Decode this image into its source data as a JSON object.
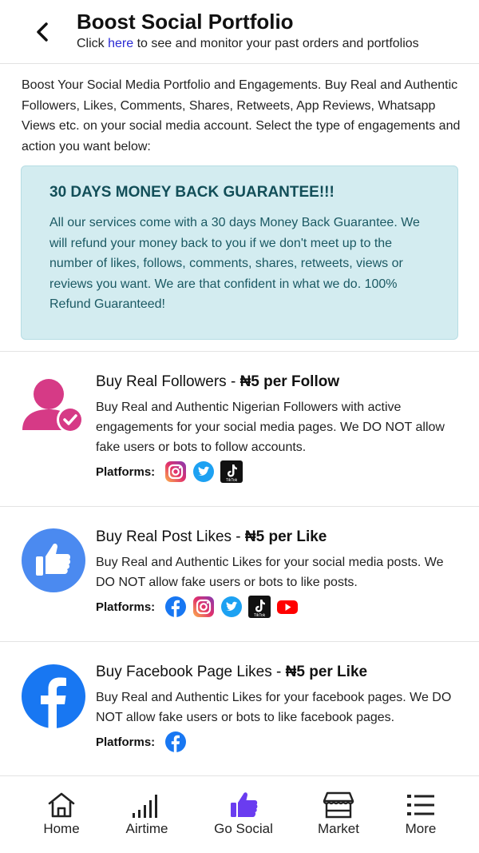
{
  "header": {
    "title": "Boost Social Portfolio",
    "subtitle_before": "Click ",
    "subtitle_link": "here",
    "subtitle_after": " to see and monitor your past orders and portfolios"
  },
  "intro": "Boost Your Social Media Portfolio and Engagements. Buy Real and Authentic Followers, Likes, Comments, Shares, Retweets, App Reviews, Whatsapp Views etc. on your social media account. Select the type of engagements and action you want below:",
  "guarantee": {
    "title": "30 DAYS MONEY BACK GUARANTEE!!!",
    "text": "All our services come with a 30 days Money Back Guarantee. We will refund your money back to you if we don't meet up to the number of likes, follows, comments, shares, retweets, views or reviews you want. We are that confident in what we do. 100% Refund Guaranteed!"
  },
  "services": [
    {
      "title": "Buy Real Followers - ",
      "price": "₦5 per Follow",
      "description": "Buy Real and Authentic Nigerian Followers with active engagements for your social media pages. We DO NOT allow fake users or bots to follow accounts.",
      "platforms_label": "Platforms:",
      "platforms": [
        "instagram-icon",
        "twitter-icon",
        "tiktok-icon"
      ],
      "icon": "user-check-icon"
    },
    {
      "title": "Buy Real Post Likes - ",
      "price": "₦5 per Like",
      "description": "Buy Real and Authentic Likes for your social media posts. We DO NOT allow fake users or bots to like posts.",
      "platforms_label": "Platforms:",
      "platforms": [
        "facebook-icon",
        "instagram-icon",
        "twitter-icon",
        "tiktok-icon",
        "youtube-icon"
      ],
      "icon": "thumbs-up-icon"
    },
    {
      "title": "Buy Facebook Page Likes - ",
      "price": "₦5 per Like",
      "description": "Buy Real and Authentic Likes for your facebook pages. We DO NOT allow fake users or bots to like facebook pages.",
      "platforms_label": "Platforms:",
      "platforms": [
        "facebook-icon"
      ],
      "icon": "facebook-icon"
    }
  ],
  "tiktok_text": "TikTok",
  "bottom_nav": [
    {
      "label": "Home",
      "icon": "home-icon"
    },
    {
      "label": "Airtime",
      "icon": "signal-bars-icon"
    },
    {
      "label": "Go Social",
      "icon": "thumbs-up-icon",
      "active": true
    },
    {
      "label": "Market",
      "icon": "store-icon"
    },
    {
      "label": "More",
      "icon": "list-icon"
    }
  ],
  "colors": {
    "accent": "#6a3cf0",
    "link": "#2b2bd4",
    "guarantee_bg": "#d3ecf0",
    "guarantee_text": "#1b5963",
    "follower_icon": "#d63a86",
    "likes_icon": "#4b8af0",
    "facebook": "#1877f2",
    "youtube": "#ff0000",
    "twitter": "#1da1f2"
  }
}
